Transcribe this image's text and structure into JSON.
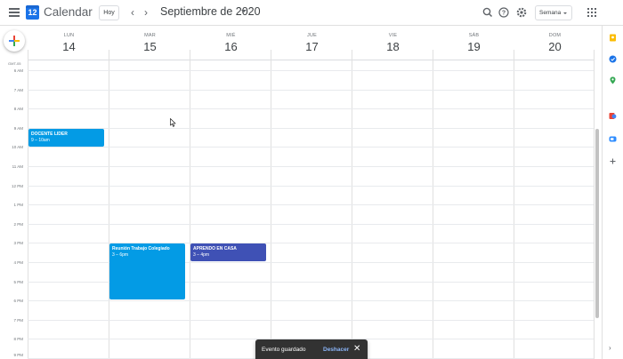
{
  "header": {
    "app_title": "Calendar",
    "logo_day": "12",
    "today_label": "Hoy",
    "prev_icon": "chevron-left-icon",
    "next_icon": "chevron-right-icon",
    "month_title": "Septiembre de 2020",
    "view_label": "Semana",
    "icons": [
      "search-icon",
      "help-icon",
      "gear-icon",
      "apps-grid-icon"
    ]
  },
  "days": [
    {
      "name": "LUN",
      "num": "14"
    },
    {
      "name": "MAR",
      "num": "15"
    },
    {
      "name": "MIÉ",
      "num": "16"
    },
    {
      "name": "JUE",
      "num": "17"
    },
    {
      "name": "VIE",
      "num": "18"
    },
    {
      "name": "SÁB",
      "num": "19"
    },
    {
      "name": "DOM",
      "num": "20"
    }
  ],
  "timezone_label": "GMT-05",
  "hours": [
    "6 AM",
    "7 AM",
    "8 AM",
    "9 AM",
    "10 AM",
    "11 AM",
    "12 PM",
    "1 PM",
    "2 PM",
    "3 PM",
    "4 PM",
    "5 PM",
    "6 PM",
    "7 PM",
    "8 PM",
    "9 PM"
  ],
  "events": [
    {
      "title": "DOCENTE LIDER",
      "time": "9 – 10am",
      "color": "#039be5"
    },
    {
      "title": "Reunión Trabajo Colegiado",
      "time": "3 – 6pm",
      "color": "#039be5"
    },
    {
      "title": "APRENDO EN CASA",
      "time": "3 – 4pm",
      "color": "#3f51b5"
    }
  ],
  "side_icons": [
    "keep-icon",
    "tasks-icon",
    "maps-icon",
    "contacts-icon",
    "zoom-icon",
    "add-icon"
  ],
  "snackbar": {
    "message": "Evento guardado",
    "action": "Deshacer"
  },
  "colors": {
    "accent": "#1a73e8",
    "event_blue": "#039be5",
    "event_indigo": "#3f51b5",
    "snackbar_bg": "#323232"
  }
}
